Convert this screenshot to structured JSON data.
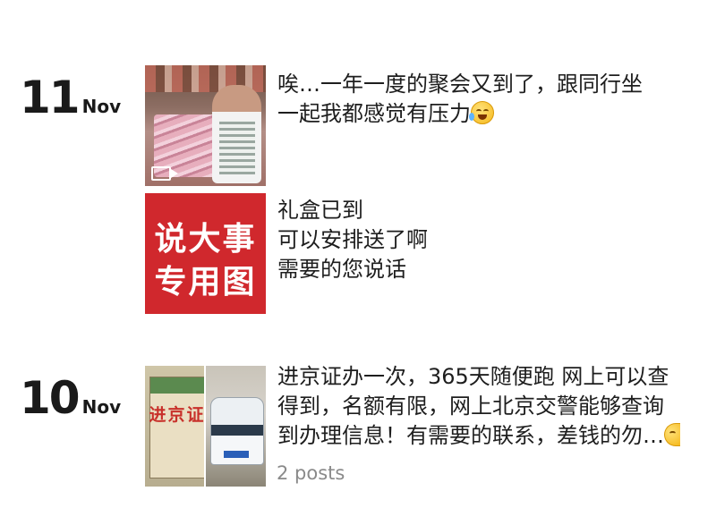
{
  "entries": [
    {
      "day": "11",
      "month": "Nov",
      "posts": [
        {
          "thumb_icon": "video-icon",
          "text_line1": "唉…一年一度的聚会又到了，跟同行坐",
          "text_line2": "一起我都感觉有压力",
          "emoji": "crying-laughing-emoji"
        },
        {
          "thumb_lines": [
            "说大事",
            "专用图"
          ],
          "text_lines": [
            "礼盒已到",
            "可以安排送了啊",
            "需要的您说话"
          ]
        }
      ]
    },
    {
      "day": "10",
      "month": "Nov",
      "posts": [
        {
          "thumb_stamp": "进京证",
          "text_lines": [
            "进京证办一次，365天随便跑 网上可以查",
            "得到，名额有限，网上北京交警能够查询",
            "到办理信息！有需要的联系，差钱的勿…"
          ],
          "emoji": "smirk-emoji",
          "count_label": "2 posts"
        }
      ]
    }
  ],
  "colors": {
    "accent_red": "#d0282d",
    "muted_text": "#8a8a8a"
  }
}
